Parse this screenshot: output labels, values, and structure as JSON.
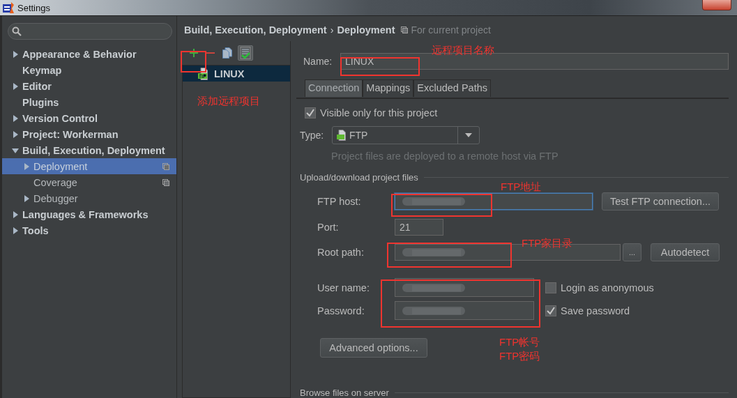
{
  "window": {
    "title": "Settings"
  },
  "sidebar": {
    "items": [
      {
        "label": "Appearance & Behavior",
        "expanded": false,
        "selected": false
      },
      {
        "label": "Keymap",
        "selected": false
      },
      {
        "label": "Editor",
        "expanded": false,
        "selected": false
      },
      {
        "label": "Plugins",
        "selected": false
      },
      {
        "label": "Version Control",
        "expanded": false,
        "selected": false
      },
      {
        "label": "Project: Workerman",
        "expanded": false,
        "selected": false
      },
      {
        "label": "Build, Execution, Deployment",
        "expanded": true,
        "selected": false,
        "children": [
          {
            "label": "Deployment",
            "expanded": false,
            "selected": true,
            "project_scoped": true
          },
          {
            "label": "Coverage",
            "selected": false,
            "project_scoped": true
          },
          {
            "label": "Debugger",
            "expanded": false,
            "selected": false
          }
        ]
      },
      {
        "label": "Languages & Frameworks",
        "expanded": false,
        "selected": false
      },
      {
        "label": "Tools",
        "expanded": false,
        "selected": false
      }
    ]
  },
  "breadcrumb": {
    "items": [
      "Build, Execution, Deployment",
      "Deployment"
    ],
    "separator": "›",
    "scope": "For current project"
  },
  "servers": [
    {
      "name": "LINUX",
      "selected": true
    }
  ],
  "name_field": {
    "label": "Name:",
    "value": "LINUX"
  },
  "tabs": [
    {
      "label": "Connection",
      "selected": true
    },
    {
      "label": "Mappings",
      "selected": false
    },
    {
      "label": "Excluded Paths",
      "selected": false
    }
  ],
  "connection": {
    "visible_only": {
      "label": "Visible only for this project",
      "checked": true
    },
    "type": {
      "label": "Type:",
      "value": "FTP",
      "hint": "Project files are deployed to a remote host via FTP"
    },
    "upload_section": "Upload/download project files",
    "ftp_host": {
      "label": "FTP host:",
      "redacted": true,
      "focused": true
    },
    "port": {
      "label": "Port:",
      "value": "21"
    },
    "root_path": {
      "label": "Root path:",
      "redacted": true
    },
    "user_name": {
      "label": "User name:",
      "redacted": true
    },
    "password": {
      "label": "Password:",
      "redacted": true
    },
    "login_anonymous": {
      "label": "Login as anonymous",
      "checked": false
    },
    "save_password": {
      "label": "Save password",
      "checked": true
    },
    "buttons": {
      "test": "Test FTP connection...",
      "browse": "...",
      "autodetect": "Autodetect",
      "advanced": "Advanced options..."
    },
    "browse_section": "Browse files on server"
  },
  "annotations": [
    {
      "text": "远程项目名称"
    },
    {
      "text": "添加远程项目"
    },
    {
      "text": "FTP地址"
    },
    {
      "text": "FTP家目录"
    },
    {
      "text": "FTP帐号"
    },
    {
      "text": "FTP密码"
    }
  ]
}
